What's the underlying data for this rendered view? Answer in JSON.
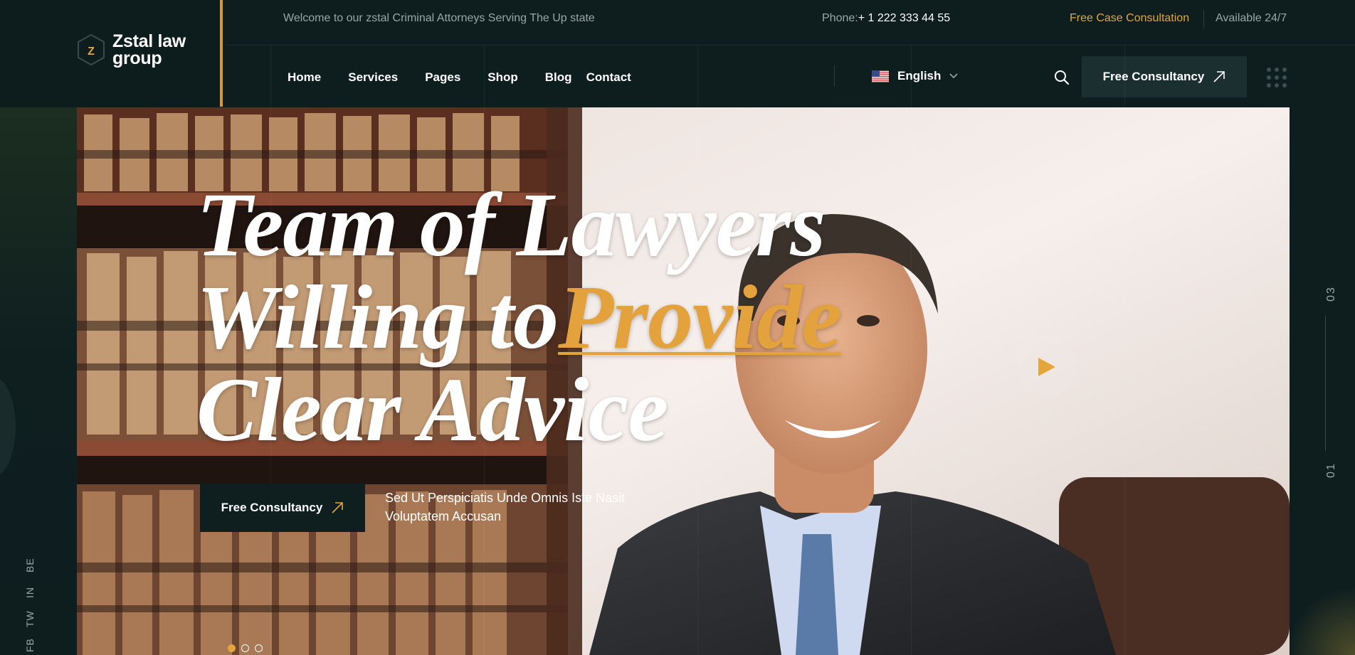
{
  "brand": {
    "name_line1": "Zstal law",
    "name_line2": "group",
    "mark_letter": "Z",
    "accent_color": "#e4a63a"
  },
  "topbar": {
    "welcome": "Welcome to our zstal Criminal Attorneys Serving The Up state",
    "phone_label": "Phone:",
    "phone_number": "+ 1 222 333 44 55",
    "free_case": "Free Case Consultation",
    "availability": "Available 24/7"
  },
  "nav": {
    "items": [
      {
        "label": "Home"
      },
      {
        "label": "Services"
      },
      {
        "label": "Pages"
      },
      {
        "label": "Shop"
      },
      {
        "label": "Blog"
      },
      {
        "label": "Contact"
      }
    ],
    "language": "English",
    "language_flag": "us-flag-icon",
    "cta_label": "Free Consultancy"
  },
  "hero": {
    "title_line1": "Team of Lawyers",
    "title_line2_plain": "Willing to",
    "title_line2_accent": "Provide",
    "title_line3": "Clear Advice",
    "cta_label": "Free Consultancy",
    "description_line1": "Sed Ut Perspiciatis Unde Omnis Iste Nasit",
    "description_line2": "Voluptatem Accusan",
    "play_icon": "play-icon",
    "slides_total": 3,
    "slide_active": 1
  },
  "slide_counter": {
    "current": "01",
    "total": "03"
  },
  "socials": [
    {
      "label": "FB"
    },
    {
      "label": "TW"
    },
    {
      "label": "IN"
    },
    {
      "label": "BE"
    }
  ]
}
